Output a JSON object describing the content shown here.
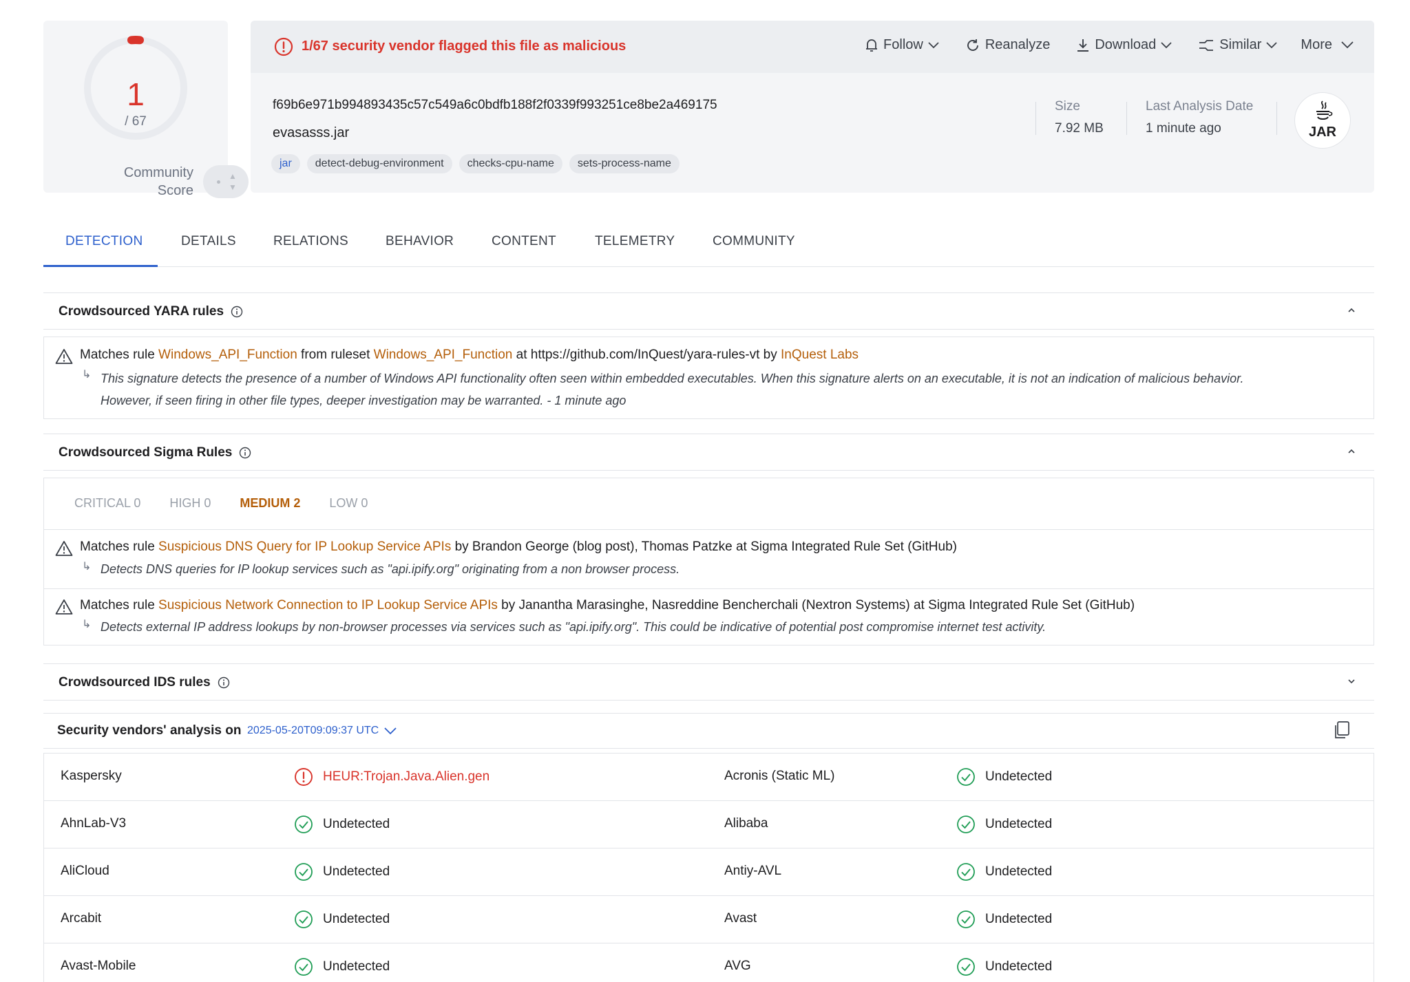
{
  "score": {
    "value": "1",
    "total": "/ 67",
    "community_label_line1": "Community",
    "community_label_line2": "Score",
    "colors": {
      "malicious": "#d9342b",
      "ring": "#e9ebef"
    }
  },
  "alert": {
    "text": "1/67 security vendor flagged this file as malicious",
    "icon": "alert-circle-icon"
  },
  "actions": [
    {
      "label": "Follow",
      "icon": "bell-icon"
    },
    {
      "label": "Reanalyze",
      "icon": "refresh-icon"
    },
    {
      "label": "Download",
      "icon": "download-icon"
    },
    {
      "label": "Similar",
      "icon": "similar-icon"
    },
    {
      "label": "More",
      "icon": "chevron-down-icon"
    }
  ],
  "file": {
    "hash": "f69b6e971b994893435c57c549a6c0bdfb188f2f0339f993251ce8be2a469175",
    "name": "evasasss.jar",
    "tags": [
      "jar",
      "detect-debug-environment",
      "checks-cpu-name",
      "sets-process-name"
    ],
    "size_label": "Size",
    "size_value": "7.92 MB",
    "date_label": "Last Analysis Date",
    "date_value": "1 minute ago",
    "type_badge": "JAR"
  },
  "tabs": [
    "DETECTION",
    "DETAILS",
    "RELATIONS",
    "BEHAVIOR",
    "CONTENT",
    "TELEMETRY",
    "COMMUNITY"
  ],
  "yara": {
    "title": "Crowdsourced YARA rules",
    "prefix": "Matches rule ",
    "rule": "Windows_API_Function",
    "mid": " from ruleset ",
    "ruleset": "Windows_API_Function",
    "at": " at https://github.com/InQuest/yara-rules-vt by ",
    "author": "InQuest Labs",
    "desc_line1": "This signature detects the presence of a number of Windows API functionality often seen within embedded executables. When this signature alerts on an executable, it is not an indication of malicious behavior.",
    "desc_line2": "However, if seen firing in other file types, deeper investigation may be warranted. - 1 minute ago"
  },
  "sigma": {
    "title": "Crowdsourced Sigma Rules",
    "severity": [
      "CRITICAL 0",
      "HIGH 0",
      "MEDIUM 2",
      "LOW 0"
    ],
    "rules": [
      {
        "prefix": "Matches rule ",
        "rule": "Suspicious DNS Query for IP Lookup Service APIs",
        "suffix": " by Brandon George (blog post), Thomas Patzke at Sigma Integrated Rule Set (GitHub)",
        "desc": "Detects DNS queries for IP lookup services such as \"api.ipify.org\" originating from a non browser process."
      },
      {
        "prefix": "Matches rule ",
        "rule": "Suspicious Network Connection to IP Lookup Service APIs",
        "suffix": " by Janantha Marasinghe, Nasreddine Bencherchali (Nextron Systems) at Sigma Integrated Rule Set (GitHub)",
        "desc": "Detects external IP address lookups by non-browser processes via services such as \"api.ipify.org\". This could be indicative of potential post compromise internet test activity."
      }
    ]
  },
  "ids": {
    "title": "Crowdsourced IDS rules"
  },
  "vendors": {
    "title": "Security vendors' analysis on",
    "date": "2025-05-20T09:09:37 UTC",
    "rows": [
      {
        "left_name": "Kaspersky",
        "left_result": "HEUR:Trojan.Java.Alien.gen",
        "left_status": "malicious",
        "right_name": "Acronis (Static ML)",
        "right_result": "Undetected",
        "right_status": "undetected"
      },
      {
        "left_name": "AhnLab-V3",
        "left_result": "Undetected",
        "left_status": "undetected",
        "right_name": "Alibaba",
        "right_result": "Undetected",
        "right_status": "undetected"
      },
      {
        "left_name": "AliCloud",
        "left_result": "Undetected",
        "left_status": "undetected",
        "right_name": "Antiy-AVL",
        "right_result": "Undetected",
        "right_status": "undetected"
      },
      {
        "left_name": "Arcabit",
        "left_result": "Undetected",
        "left_status": "undetected",
        "right_name": "Avast",
        "right_result": "Undetected",
        "right_status": "undetected"
      },
      {
        "left_name": "Avast-Mobile",
        "left_result": "Undetected",
        "left_status": "undetected",
        "right_name": "AVG",
        "right_result": "Undetected",
        "right_status": "undetected"
      }
    ]
  }
}
